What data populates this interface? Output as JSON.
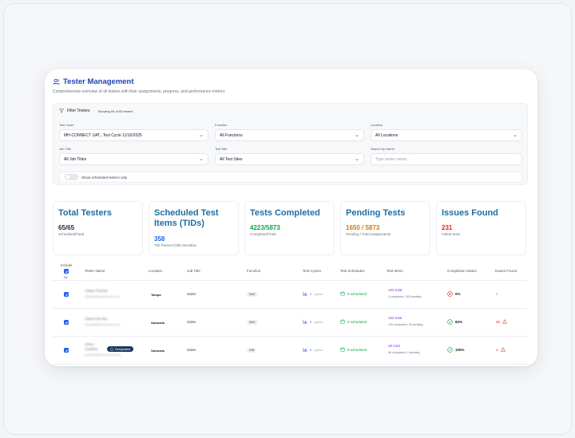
{
  "header": {
    "title": "Tester Management",
    "subtitle": "Comprehensive overview of all testers with their assignments, progress, and performance metrics"
  },
  "filters": {
    "title": "Filter Testers",
    "count": "Showing 65 of 65 testers",
    "test_cycle": {
      "label": "Test Cycle",
      "value": "MH-CONNECT UAT...Test Cycle 11/10/2025"
    },
    "function": {
      "label": "Function",
      "value": "All Functions"
    },
    "location": {
      "label": "Location",
      "value": "All Locations"
    },
    "job_title": {
      "label": "Job Title",
      "value": "All Job Titles"
    },
    "test_site": {
      "label": "Test Site",
      "value": "All Test Sites"
    },
    "search": {
      "label": "Search by Name",
      "placeholder": "Type tester name..."
    },
    "toggle_label": "Show scheduled testers only"
  },
  "stats": [
    {
      "title": "Total Testers",
      "value": "65/65",
      "sub": "Scheduled/Total",
      "color": "#1f2937"
    },
    {
      "title": "Scheduled Test Items (TIDs)",
      "value": "358",
      "sub": "TID Parent-Child Sensitive",
      "color": "#2563eb"
    },
    {
      "title": "Tests Completed",
      "value": "4223/5873",
      "sub": "Completed/Total",
      "color": "#16a34a"
    },
    {
      "title": "Pending Tests",
      "value": "1650 / 5873",
      "sub": "Pending / Total assignments",
      "color": "#d97706"
    },
    {
      "title": "Issues Found",
      "value": "231",
      "sub": "Failed tests",
      "color": "#dc2626"
    }
  ],
  "table": {
    "headers": {
      "include": "Include",
      "all": "All",
      "name": "Tester Name",
      "location": "Location",
      "job_title": "Job Title",
      "function": "Function",
      "cycles": "Test Cycles",
      "schedules": "Test Schedules",
      "items": "Test Items",
      "completion": "Completion Status",
      "issues": "Issues Found"
    },
    "rows": [
      {
        "name": "Adrian Fischer",
        "email": "afischer@mhconnect.com",
        "location": "Tampa",
        "job_title": "Sales",
        "function": "NHC",
        "cycles_num": "0",
        "cycles_text": "cycles",
        "schedules": "0 scheduled",
        "items_total": "163 total",
        "items_sub": "0 completed, 163 pending",
        "completion": "0%",
        "issues": "0"
      },
      {
        "name": "Alaina Nicolas",
        "email": "anicolas@mhconnect.com",
        "location": "Sarasota",
        "job_title": "Sales",
        "function": "NHC",
        "cycles_num": "0",
        "cycles_text": "cycles",
        "schedules": "0 scheduled",
        "items_total": "153 total",
        "items_sub": "120 completed, 33 pending",
        "completion": "82%",
        "issues": "25"
      },
      {
        "name": "Alexa Custeris",
        "email": "acusteris@mhconnect.com",
        "badge": "Designated",
        "location": "Sarasota",
        "job_title": "Sales",
        "function": "ION",
        "cycles_num": "0",
        "cycles_text": "cycles",
        "schedules": "0 scheduled",
        "items_total": "48 total",
        "items_sub": "46 completed, 2 pending",
        "completion": "100%",
        "issues": "1"
      }
    ]
  },
  "colors": {
    "accent": "#2563eb",
    "title": "#1e40af",
    "success": "#16a34a",
    "warning": "#d97706",
    "danger": "#dc2626",
    "purple": "#9333ea"
  }
}
